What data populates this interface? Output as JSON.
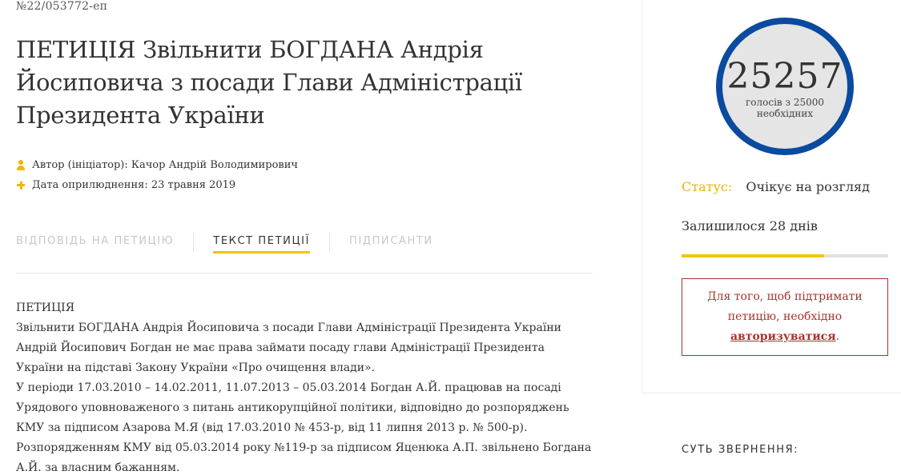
{
  "petition": {
    "number": "№22/053772-еп",
    "title": "ПЕТИЦІЯ Звільнити БОГДАНА Андрія Йосиповича з посади Глави Адміністрації Президента України",
    "author": "Автор (ініціатор): Качор Андрій Володимирович",
    "published": "Дата оприлюднення: 23 травня 2019"
  },
  "tabs": [
    {
      "label": "ВІДПОВІДЬ НА ПЕТИЦІЮ",
      "active": false
    },
    {
      "label": "ТЕКСТ ПЕТИЦІЇ",
      "active": true
    },
    {
      "label": "ПІДПИСАНТИ",
      "active": false
    }
  ],
  "body": {
    "heading": "ПЕТИЦІЯ",
    "paragraphs": [
      "Звільнити БОГДАНА Андрія Йосиповича з посади Глави Адміністрації Президента України",
      "Андрій Йосипович Богдан не має права займати посаду глави Адміністрації Президента України на підставі Закону України «Про очищення влади».",
      "У періоди 17.03.2010 – 14.02.2011, 11.07.2013 – 05.03.2014 Богдан А.Й. працював на посаді Урядового уповноваженого з питань антикорупційної політики, відповідно до розпоряджень КМУ за підписом Азарова М.Я (від 17.03.2010 № 453-р, від 11 липня 2013 р. № 500-р).",
      "Розпорядженням КМУ від 05.03.2014 року №119-р за підписом Яценюка А.П. звільнено Богдана А.Й. за власним бажанням."
    ]
  },
  "sidebar": {
    "votes": "25257",
    "votes_caption": "голосів з 25000 необхідних",
    "status_label": "Статус:",
    "status_value": "Очікує на розгляд",
    "remaining": "Залишилося 28 днів",
    "progress_fraction": 0.69,
    "auth_text_before": "Для того, щоб підтримати петицію, необхідно",
    "auth_link": "авторизуватися",
    "auth_text_after": ".",
    "essence_heading": "СУТЬ ЗВЕРНЕННЯ:"
  },
  "colors": {
    "accent_yellow": "#f2c500",
    "circle_blue": "#0a4a9f",
    "auth_red": "#a8322c"
  }
}
